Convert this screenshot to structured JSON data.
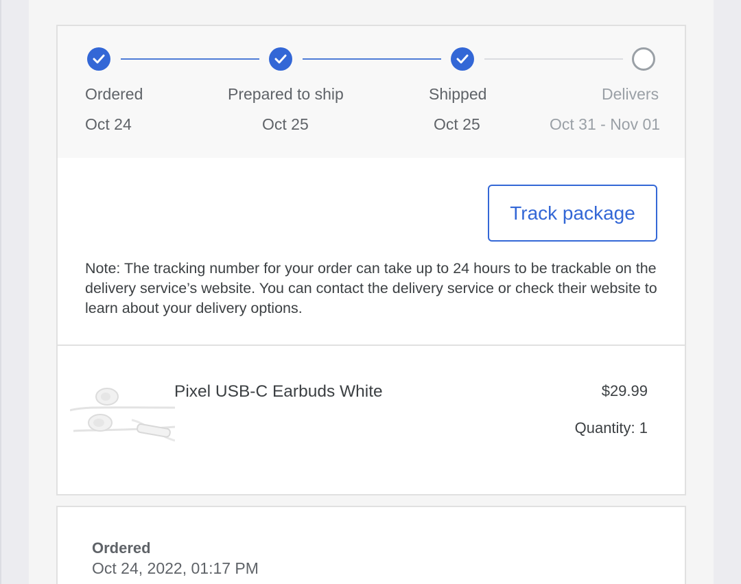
{
  "progress": {
    "steps": [
      {
        "label": "Ordered",
        "date": "Oct 24",
        "status": "complete"
      },
      {
        "label": "Prepared to ship",
        "date": "Oct 25",
        "status": "complete"
      },
      {
        "label": "Shipped",
        "date": "Oct 25",
        "status": "complete"
      },
      {
        "label": "Delivers",
        "date": "Oct 31 - Nov 01",
        "status": "pending"
      }
    ]
  },
  "shipment": {
    "track_button": "Track package",
    "note": "Note: The tracking number for your order can take up to 24 hours to be trackable on the delivery service’s website. You can contact the delivery service or check their website to learn about your delivery options."
  },
  "item": {
    "name": "Pixel USB-C Earbuds White",
    "price": "$29.99",
    "quantity": "Quantity: 1"
  },
  "history": {
    "title": "Ordered",
    "timestamp": "Oct 24, 2022, 01:17 PM"
  },
  "colors": {
    "accent": "#3367d6",
    "complete_step": "#3367d6",
    "pending_step": "#9aa0a6",
    "text": "#3c4043"
  }
}
